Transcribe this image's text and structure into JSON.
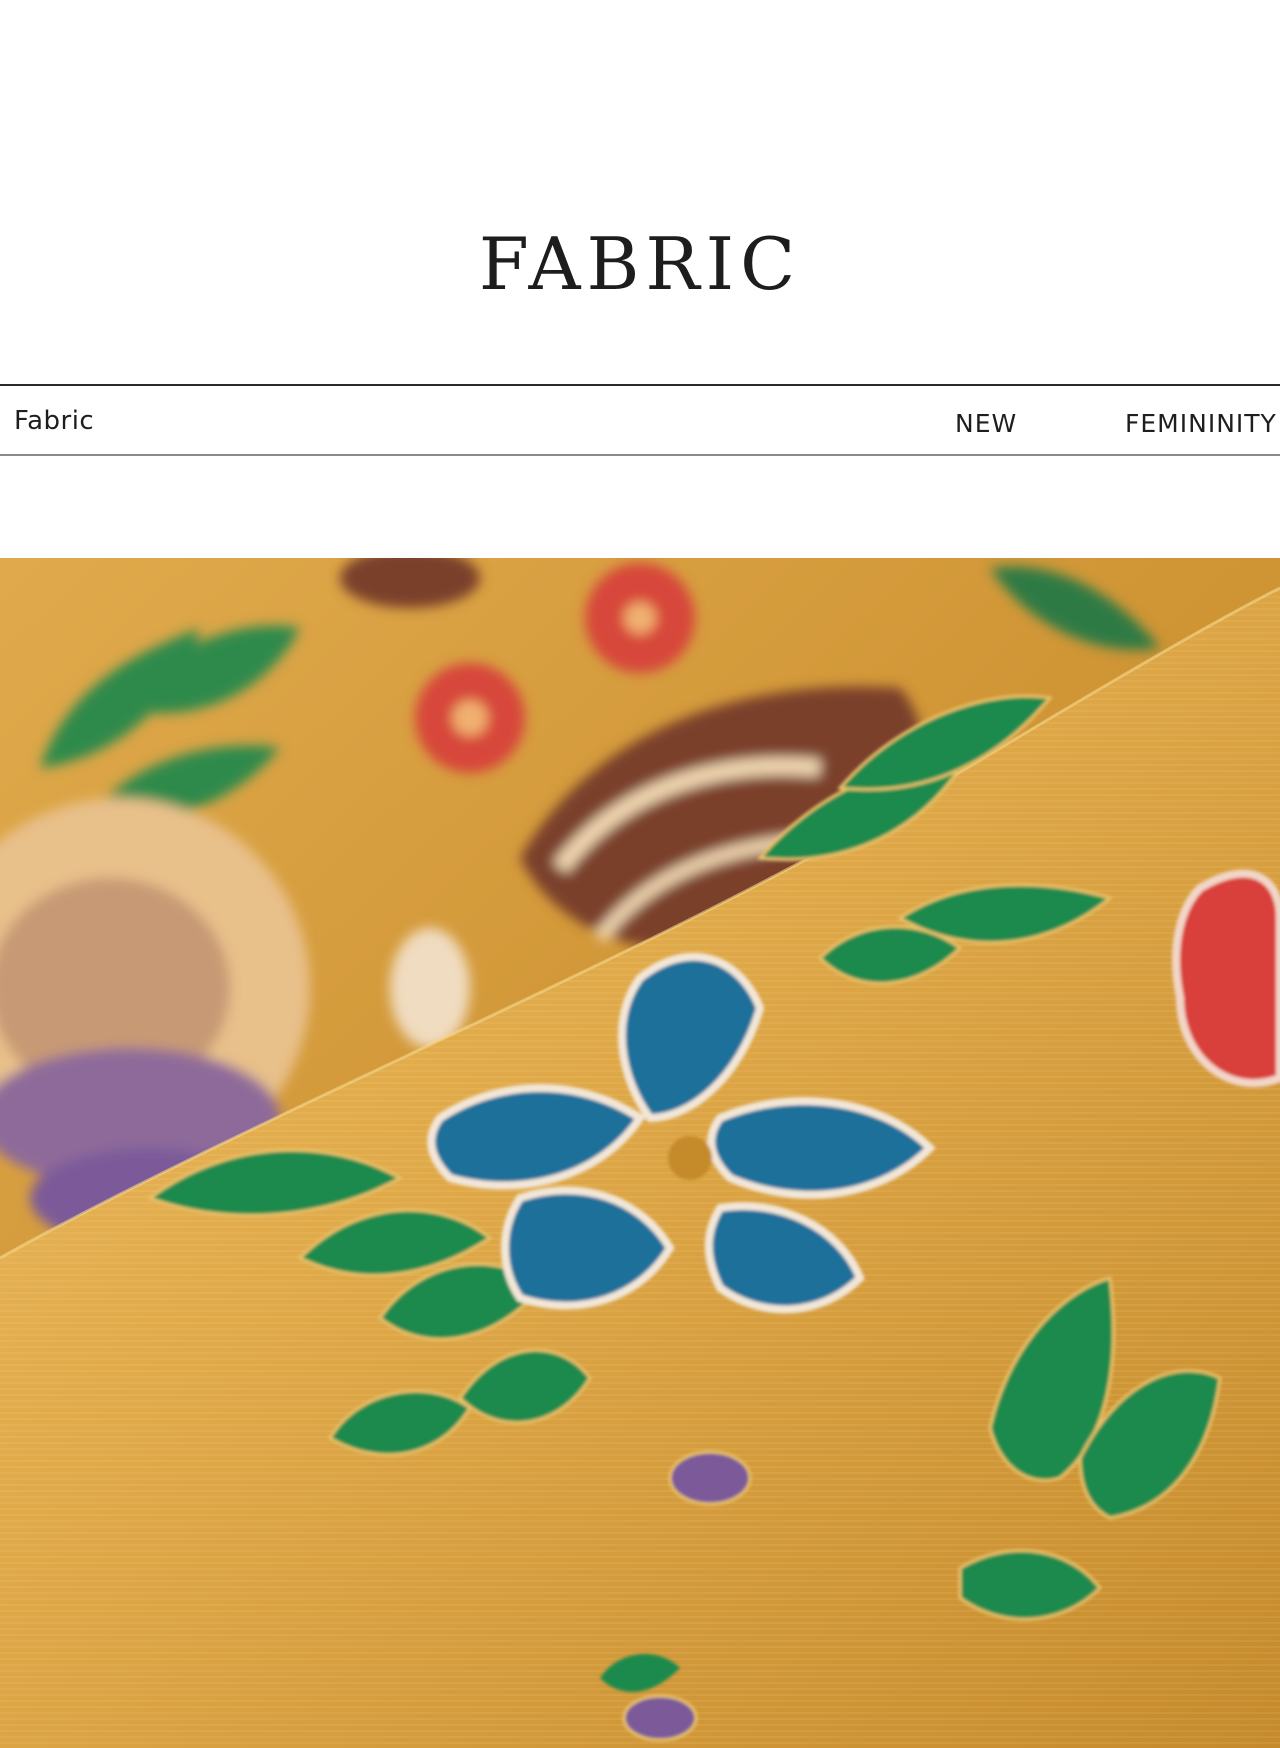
{
  "header": {
    "title": "FABRIC"
  },
  "section_bar": {
    "left_label": "Fabric",
    "middle_label": "NEW",
    "right_label": "FEMININITY"
  },
  "photo": {
    "subject": "gold-brocade-floral-fabric-icon",
    "colors": {
      "gold": "#d9a13e",
      "dark_gold": "#b57a22",
      "green": "#1f8a4e",
      "blue": "#1f6f9a",
      "red": "#d9403a",
      "brown": "#7a3f2c",
      "purple": "#7b5a9a"
    }
  }
}
